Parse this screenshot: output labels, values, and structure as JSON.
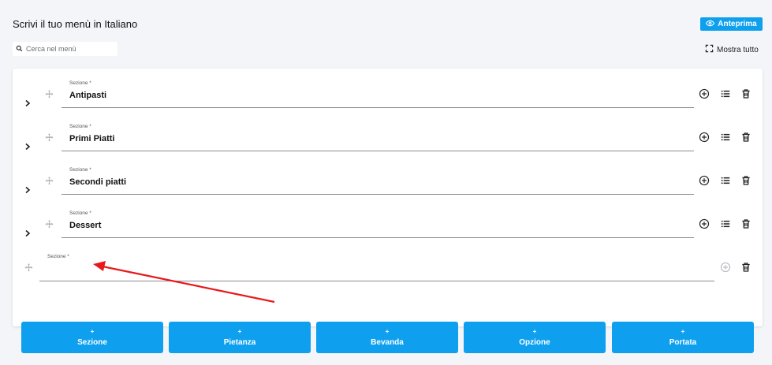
{
  "header": {
    "title": "Scrivi il tuo menù in Italiano",
    "preview_label": "Anteprima",
    "expand_all_label": "Mostra tutto"
  },
  "search": {
    "placeholder": "Cerca nel menù",
    "value": ""
  },
  "sections": [
    {
      "label": "Sezione *",
      "value": "Antipasti"
    },
    {
      "label": "Primi Piatti",
      "value": "Primi Piatti"
    },
    {
      "label": "Sezione *",
      "value": "Secondi piatti"
    },
    {
      "label": "Sezione *",
      "value": "Dessert"
    }
  ],
  "new_section": {
    "label": "Sezione *",
    "value": ""
  },
  "add_buttons": [
    {
      "plus": "+",
      "label": "Sezione"
    },
    {
      "plus": "+",
      "label": "Pietanza"
    },
    {
      "plus": "+",
      "label": "Bevanda"
    },
    {
      "plus": "+",
      "label": "Opzione"
    },
    {
      "plus": "+",
      "label": "Portata"
    }
  ],
  "colors": {
    "accent": "#0ea0ee",
    "annotation_arrow": "#e8191b",
    "background": "#f4f5f8"
  }
}
